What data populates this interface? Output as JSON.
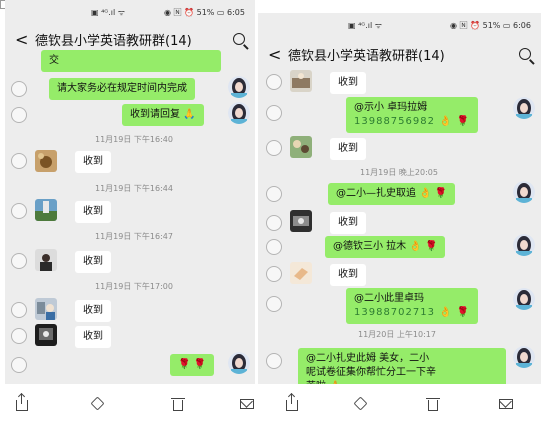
{
  "left": {
    "status_signal": "▣ ⁴ᴳ.ıl ᯤ",
    "status_right": "◉ 🄽 ⏰ 51% ▭ 6:05",
    "back": "<",
    "title": "德钦县小学英语教研群(14)",
    "messages": {
      "m1": "交",
      "m2": "请大家务必在规定时间内完成",
      "m3": "收到请回复",
      "t1": "11月19日 下午16:40",
      "m4": "收到",
      "t2": "11月19日 下午16:44",
      "m5": "收到",
      "t3": "11月19日 下午16:47",
      "m6": "收到",
      "t4": "11月19日 下午17:00",
      "m7": "收到",
      "m8": "收到",
      "m9": "🌹 🌹"
    }
  },
  "right": {
    "status_signal": "▣ ⁴ᴳ.ıl ᯤ",
    "status_right": "◉ 🄽 ⏰ 51% ▭ 6:06",
    "back": "<",
    "title": "德钦县小学英语教研群(14)",
    "messages": {
      "m1": "收到",
      "m2a": "@示小 卓玛拉姆",
      "m2b": "13988756982",
      "m3": "收到",
      "t1": "11月19日 晚上20:05",
      "m4": "@二小—扎史取追",
      "m5": "收到",
      "m6": "@德钦三小  拉木",
      "m7": "收到",
      "m8a": "@二小此里卓玛",
      "m8b": "13988702713",
      "t2": "11月20日 上午10:17",
      "m9a": "@二小扎史此姆  美女，二小",
      "m9b": "呢试卷征集你帮忙分工一下辛",
      "m9c": "苦啦"
    }
  },
  "emoji": {
    "ok_hand": "👌",
    "rose": "🌹",
    "clap": "🙏"
  },
  "toolbar_icons": [
    "share-icon",
    "cube-icon",
    "trash-icon",
    "mail-icon"
  ],
  "colors": {
    "green_bubble": "#95ec69",
    "chat_bg": "#ededed"
  }
}
